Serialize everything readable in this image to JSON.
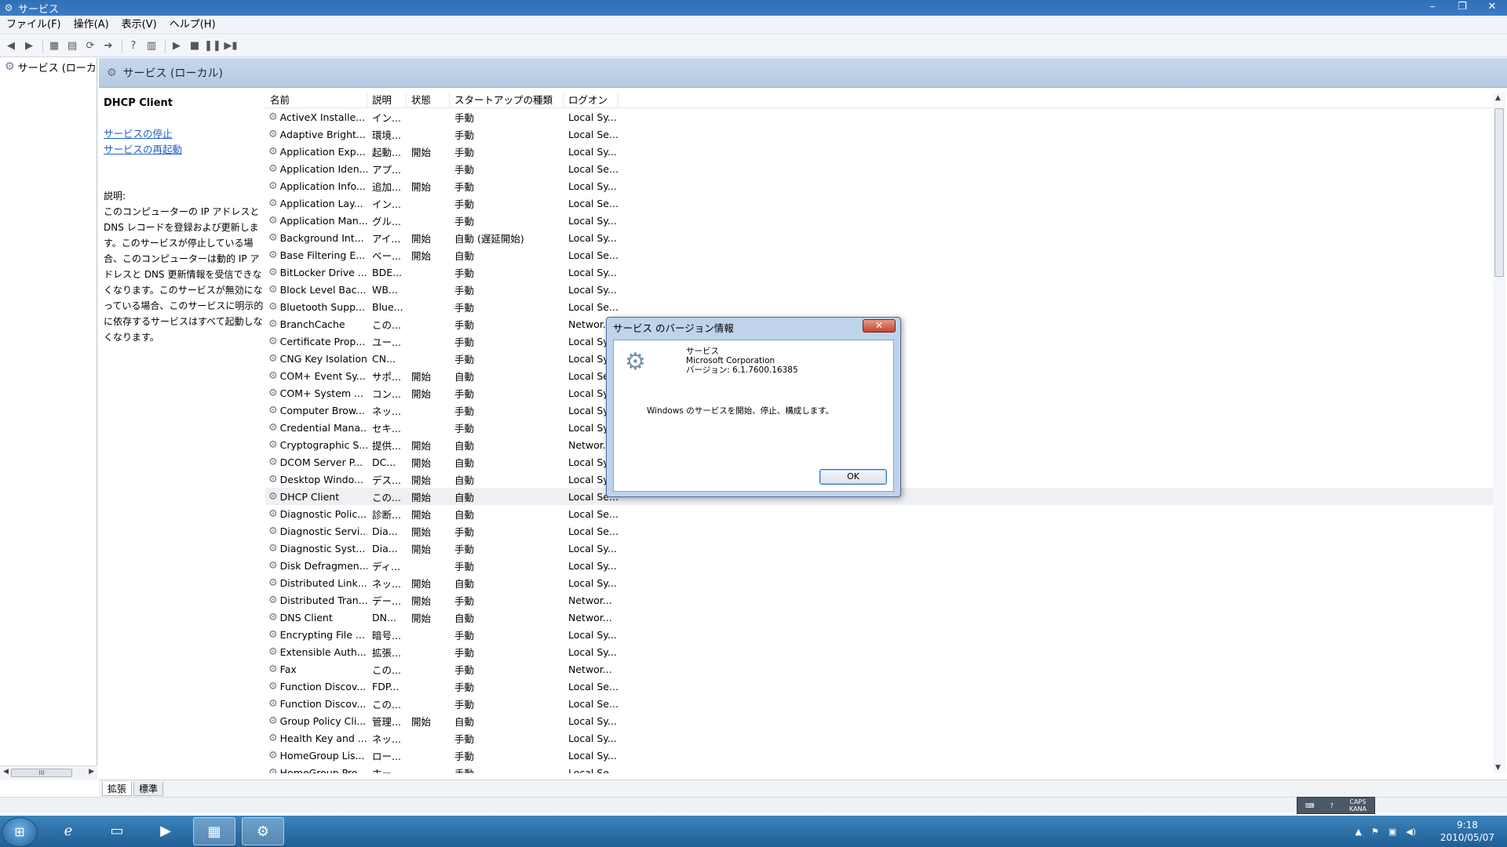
{
  "window": {
    "title": "サービス",
    "controls": [
      "–",
      "❐",
      "✕"
    ]
  },
  "menu": [
    "ファイル(F)",
    "操作(A)",
    "表示(V)",
    "ヘルプ(H)"
  ],
  "tree": {
    "root_label": "サービス (ローカ"
  },
  "main": {
    "header": "サービス (ローカル)",
    "selected_service": "DHCP Client",
    "links": [
      "サービスの停止",
      "サービスの再起動"
    ],
    "desc_label": "説明:",
    "desc_text": "このコンピューターの IP アドレスと DNS レコードを登録および更新します。このサービスが停止している場合、このコンピューターは動的 IP アドレスと DNS 更新情報を受信できなくなります。このサービスが無効になっている場合、このサービスに明示的に依存するサービスはすべて起動しなくなります。"
  },
  "table": {
    "columns": [
      "名前",
      "説明",
      "状態",
      "スタートアップの種類",
      "ログオン"
    ],
    "sort_indicator": "ˆ",
    "rows": [
      [
        "ActiveX Installe...",
        "イン...",
        "",
        "手動",
        "Local Sy..."
      ],
      [
        "Adaptive Bright...",
        "環境...",
        "",
        "手動",
        "Local Se..."
      ],
      [
        "Application Exp...",
        "起動...",
        "開始",
        "手動",
        "Local Sy..."
      ],
      [
        "Application Iden...",
        "アプ...",
        "",
        "手動",
        "Local Se..."
      ],
      [
        "Application Info...",
        "追加...",
        "開始",
        "手動",
        "Local Sy..."
      ],
      [
        "Application Lay...",
        "イン...",
        "",
        "手動",
        "Local Se..."
      ],
      [
        "Application Man...",
        "グル...",
        "",
        "手動",
        "Local Sy..."
      ],
      [
        "Background Int...",
        "アイ...",
        "開始",
        "自動 (遅延開始)",
        "Local Sy..."
      ],
      [
        "Base Filtering E...",
        "ベー...",
        "開始",
        "自動",
        "Local Se..."
      ],
      [
        "BitLocker Drive ...",
        "BDE...",
        "",
        "手動",
        "Local Sy..."
      ],
      [
        "Block Level Bac...",
        "WB...",
        "",
        "手動",
        "Local Sy..."
      ],
      [
        "Bluetooth Supp...",
        "Blue...",
        "",
        "手動",
        "Local Se..."
      ],
      [
        "BranchCache",
        "この...",
        "",
        "手動",
        "Networ..."
      ],
      [
        "Certificate Prop...",
        "ユー...",
        "",
        "手動",
        "Local Sy..."
      ],
      [
        "CNG Key Isolation",
        "CN...",
        "",
        "手動",
        "Local Sy..."
      ],
      [
        "COM+ Event Sy...",
        "サポ...",
        "開始",
        "自動",
        "Local Se..."
      ],
      [
        "COM+ System ...",
        "コン...",
        "開始",
        "手動",
        "Local Sy..."
      ],
      [
        "Computer Brow...",
        "ネッ...",
        "",
        "手動",
        "Local Sy..."
      ],
      [
        "Credential Mana...",
        "セキ...",
        "",
        "手動",
        "Local Sy..."
      ],
      [
        "Cryptographic S...",
        "提供...",
        "開始",
        "自動",
        "Networ..."
      ],
      [
        "DCOM Server P...",
        "DC...",
        "開始",
        "自動",
        "Local Sy..."
      ],
      [
        "Desktop Windo...",
        "デス...",
        "開始",
        "自動",
        "Local Sy..."
      ],
      [
        "DHCP Client",
        "この...",
        "開始",
        "自動",
        "Local Se..."
      ],
      [
        "Diagnostic Polic...",
        "診断...",
        "開始",
        "自動",
        "Local Se..."
      ],
      [
        "Diagnostic Servi...",
        "Dia...",
        "開始",
        "手動",
        "Local Se..."
      ],
      [
        "Diagnostic Syst...",
        "Dia...",
        "開始",
        "手動",
        "Local Sy..."
      ],
      [
        "Disk Defragmen...",
        "ディ...",
        "",
        "手動",
        "Local Sy..."
      ],
      [
        "Distributed Link...",
        "ネッ...",
        "開始",
        "自動",
        "Local Sy..."
      ],
      [
        "Distributed Tran...",
        "デー...",
        "開始",
        "手動",
        "Networ..."
      ],
      [
        "DNS Client",
        "DN...",
        "開始",
        "自動",
        "Networ..."
      ],
      [
        "Encrypting File ...",
        "暗号...",
        "",
        "手動",
        "Local Sy..."
      ],
      [
        "Extensible Auth...",
        "拡張...",
        "",
        "手動",
        "Local Sy..."
      ],
      [
        "Fax",
        "この...",
        "",
        "手動",
        "Networ..."
      ],
      [
        "Function Discov...",
        "FDP...",
        "",
        "手動",
        "Local Se..."
      ],
      [
        "Function Discov...",
        "この...",
        "",
        "手動",
        "Local Se..."
      ],
      [
        "Group Policy Cli...",
        "管理...",
        "開始",
        "自動",
        "Local Sy..."
      ],
      [
        "Health Key and ...",
        "ネッ...",
        "",
        "手動",
        "Local Sy..."
      ],
      [
        "HomeGroup Lis...",
        "ロー...",
        "",
        "手動",
        "Local Sy..."
      ],
      [
        "HomeGroup Pro...",
        "ホー...",
        "",
        "手動",
        "Local Se..."
      ]
    ],
    "selected_row": 22
  },
  "tabs": [
    "拡張",
    "標準"
  ],
  "dialog": {
    "title": "サービス のバージョン情報",
    "close": "✕",
    "product": "サービス",
    "company": "Microsoft Corporation",
    "version": "バージョン: 6.1.7600.16385",
    "message": "Windows のサービスを開始、停止、構成します。",
    "ok": "OK"
  },
  "langbar": {
    "caps": "CAPS",
    "kana": "KANA"
  },
  "taskbar": {
    "time": "9:18",
    "date": "2010/05/07"
  }
}
